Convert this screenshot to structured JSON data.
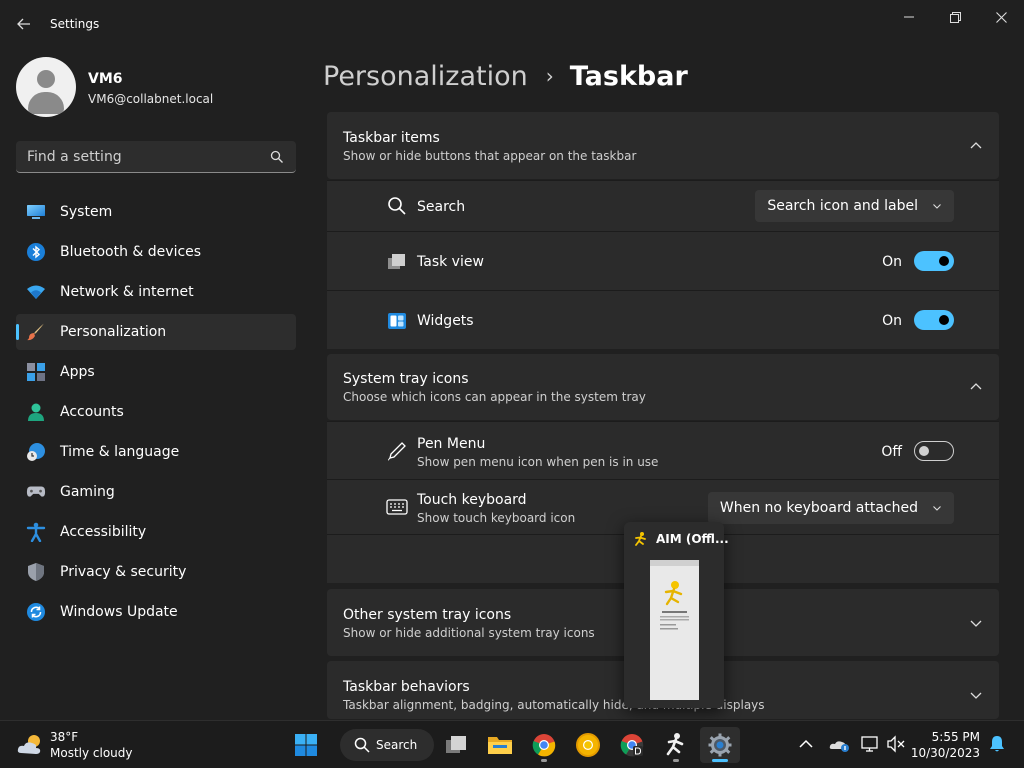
{
  "window": {
    "title": "Settings",
    "back_icon": "arrow-left-icon",
    "minimize_icon": "minimize-icon",
    "maximize_icon": "restore-icon",
    "close_icon": "close-icon"
  },
  "profile": {
    "name": "VM6",
    "email": "VM6@collabnet.local"
  },
  "search": {
    "placeholder": "Find a setting",
    "icon": "search-icon"
  },
  "sidebar": {
    "items": [
      {
        "label": "System",
        "icon": "monitor-icon"
      },
      {
        "label": "Bluetooth & devices",
        "icon": "bluetooth-icon"
      },
      {
        "label": "Network & internet",
        "icon": "wifi-icon"
      },
      {
        "label": "Personalization",
        "icon": "brush-icon",
        "active": true
      },
      {
        "label": "Apps",
        "icon": "apps-icon"
      },
      {
        "label": "Accounts",
        "icon": "person-icon"
      },
      {
        "label": "Time & language",
        "icon": "globe-clock-icon"
      },
      {
        "label": "Gaming",
        "icon": "gamepad-icon"
      },
      {
        "label": "Accessibility",
        "icon": "accessibility-icon"
      },
      {
        "label": "Privacy & security",
        "icon": "shield-icon"
      },
      {
        "label": "Windows Update",
        "icon": "update-icon"
      }
    ]
  },
  "header": {
    "parent": "Personalization",
    "separator": "›",
    "current": "Taskbar"
  },
  "taskbar_items": {
    "title": "Taskbar items",
    "subtitle": "Show or hide buttons that appear on the taskbar",
    "expanded": true,
    "rows": {
      "search": {
        "label": "Search",
        "value": "Search icon and label",
        "icon": "search-icon"
      },
      "task_view": {
        "label": "Task view",
        "state_label": "On",
        "on": true,
        "icon": "task-view-icon"
      },
      "widgets": {
        "label": "Widgets",
        "state_label": "On",
        "on": true,
        "icon": "widgets-icon"
      }
    }
  },
  "system_tray": {
    "title": "System tray icons",
    "subtitle": "Choose which icons can appear in the system tray",
    "expanded": true,
    "rows": {
      "pen_menu": {
        "label": "Pen Menu",
        "sub": "Show pen menu icon when pen is in use",
        "state_label": "Off",
        "on": false,
        "icon": "pen-icon"
      },
      "touch_keyboard": {
        "label": "Touch keyboard",
        "sub": "Show touch keyboard icon",
        "value": "When no keyboard attached",
        "icon": "keyboard-icon"
      }
    }
  },
  "other_tray": {
    "title": "Other system tray icons",
    "subtitle": "Show or hide additional system tray icons",
    "expanded": false
  },
  "behaviors": {
    "title": "Taskbar behaviors",
    "subtitle": "Taskbar alignment, badging, automatically hide, and multiple displays",
    "expanded": false
  },
  "popup": {
    "title": "AIM (Offl...",
    "icon": "aim-running-man-icon"
  },
  "taskbar": {
    "weather": {
      "temp": "38°F",
      "desc": "Mostly cloudy",
      "icon": "cloud-sun-icon"
    },
    "search_label": "Search",
    "apps": [
      {
        "name": "start-button",
        "icon": "windows-logo-icon"
      },
      {
        "name": "task-view-button",
        "icon": "task-view-icon"
      },
      {
        "name": "file-explorer-button",
        "icon": "folder-icon"
      },
      {
        "name": "chrome-button",
        "icon": "chrome-icon",
        "running": true
      },
      {
        "name": "chrome-canary-button",
        "icon": "chrome-canary-icon"
      },
      {
        "name": "chrome-dev-button",
        "icon": "chrome-dev-icon"
      },
      {
        "name": "aim-button",
        "icon": "aim-running-man-icon",
        "running": true
      },
      {
        "name": "settings-button",
        "icon": "gear-icon",
        "running": true,
        "active": true
      }
    ],
    "tray": {
      "chevron_icon": "chevron-up-icon",
      "onedrive_icon": "onedrive-icon",
      "network_icon": "network-icon",
      "volume_icon": "volume-muted-icon",
      "notification_icon": "bell-icon"
    },
    "clock": {
      "time": "5:55 PM",
      "date": "10/30/2023"
    }
  },
  "colors": {
    "accent": "#4cc2ff",
    "background": "#202020",
    "card": "#2b2b2b"
  }
}
